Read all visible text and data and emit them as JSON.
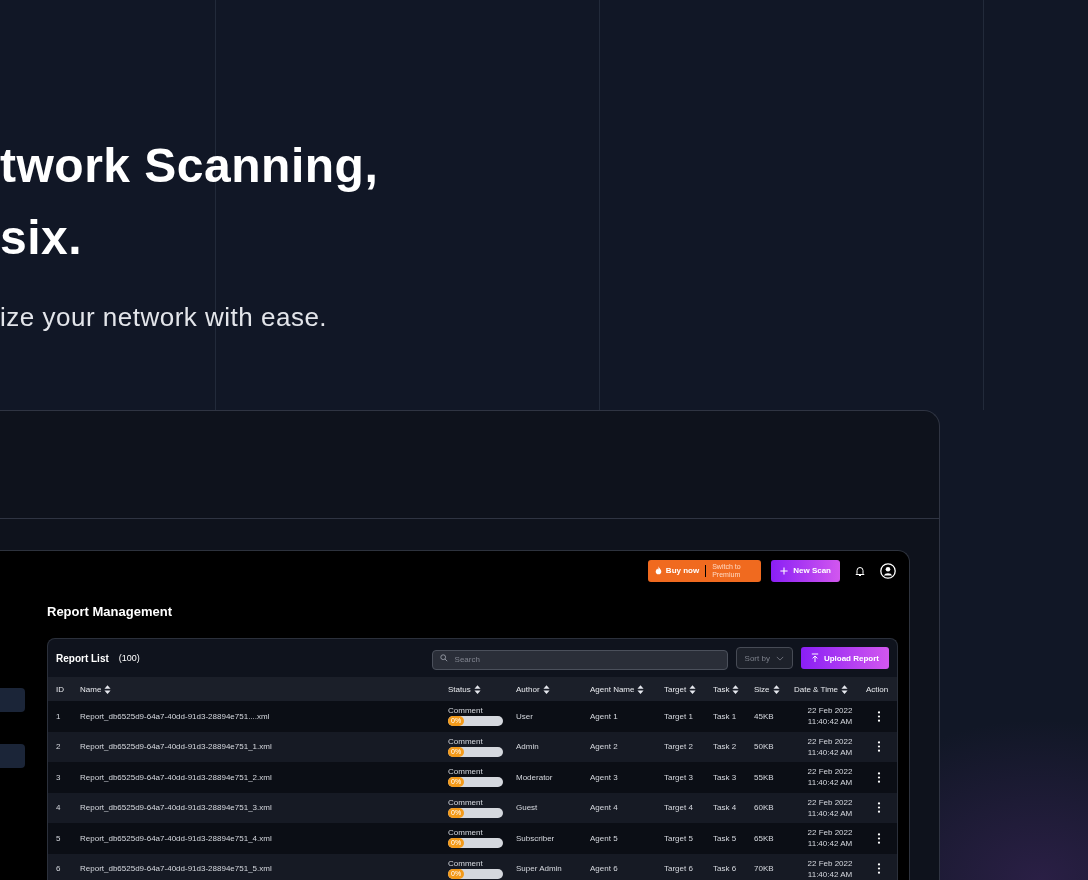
{
  "hero": {
    "heading_lines": [
      "twork Scanning,",
      "six."
    ],
    "subtitle": "ize your network with ease."
  },
  "sidebar": {
    "items": [
      {
        "kind": "pill"
      },
      {
        "kind": "pill"
      }
    ]
  },
  "topbar": {
    "buy_button": {
      "label": "Buy now",
      "note": "Switch to Premium"
    },
    "new_scan_button": {
      "label": "New Scan"
    }
  },
  "page_title": "Report Management",
  "report_list": {
    "title": "Report List",
    "count": "(100)",
    "search": {
      "placeholder": "Search"
    },
    "sort": {
      "label": "Sort by"
    },
    "upload_button": {
      "label": "Upload Report"
    }
  },
  "table": {
    "columns": [
      {
        "label": "ID",
        "sortable": false
      },
      {
        "label": "Name",
        "sortable": true
      },
      {
        "label": "Status",
        "sortable": true
      },
      {
        "label": "Author",
        "sortable": true
      },
      {
        "label": "Agent Name",
        "sortable": true
      },
      {
        "label": "Target",
        "sortable": true
      },
      {
        "label": "Task",
        "sortable": true
      },
      {
        "label": "Size",
        "sortable": true
      },
      {
        "label": "Date & Time",
        "sortable": true
      },
      {
        "label": "Action",
        "sortable": false
      }
    ],
    "rows": [
      {
        "id": "1",
        "name": "Report_db6525d9-64a7-40dd-91d3-28894e751....xml",
        "status": "Comment",
        "progress": "0%",
        "level": 0,
        "author": "User",
        "agent": "Agent 1",
        "target": "Target 1",
        "task": "Task 1",
        "size": "45KB",
        "date": "22 Feb 2022",
        "time": "11:40:42 AM"
      },
      {
        "id": "2",
        "name": "Report_db6525d9-64a7-40dd-91d3-28894e751_1.xml",
        "status": "Comment",
        "progress": "0%",
        "level": 0,
        "author": "Admin",
        "agent": "Agent 2",
        "target": "Target 2",
        "task": "Task 2",
        "size": "50KB",
        "date": "22 Feb 2022",
        "time": "11:40:42 AM"
      },
      {
        "id": "3",
        "name": "Report_db6525d9-64a7-40dd-91d3-28894e751_2.xml",
        "status": "Comment",
        "progress": "0%",
        "level": 0,
        "author": "Moderator",
        "agent": "Agent 3",
        "target": "Target 3",
        "task": "Task 3",
        "size": "55KB",
        "date": "22 Feb 2022",
        "time": "11:40:42 AM"
      },
      {
        "id": "4",
        "name": "Report_db6525d9-64a7-40dd-91d3-28894e751_3.xml",
        "status": "Comment",
        "progress": "0%",
        "level": 0,
        "author": "Guest",
        "agent": "Agent 4",
        "target": "Target 4",
        "task": "Task 4",
        "size": "60KB",
        "date": "22 Feb 2022",
        "time": "11:40:42 AM"
      },
      {
        "id": "5",
        "name": "Report_db6525d9-64a7-40dd-91d3-28894e751_4.xml",
        "status": "Comment",
        "progress": "0%",
        "level": 0,
        "author": "Subscriber",
        "agent": "Agent 5",
        "target": "Target 5",
        "task": "Task 5",
        "size": "65KB",
        "date": "22 Feb 2022",
        "time": "11:40:42 AM"
      },
      {
        "id": "6",
        "name": "Report_db6525d9-64a7-40dd-91d3-28894e751_5.xml",
        "status": "Comment",
        "progress": "0%",
        "level": 0,
        "author": "Super Admin",
        "agent": "Agent 6",
        "target": "Target 6",
        "task": "Task 6",
        "size": "70KB",
        "date": "22 Feb 2022",
        "time": "11:40:42 AM"
      }
    ]
  }
}
